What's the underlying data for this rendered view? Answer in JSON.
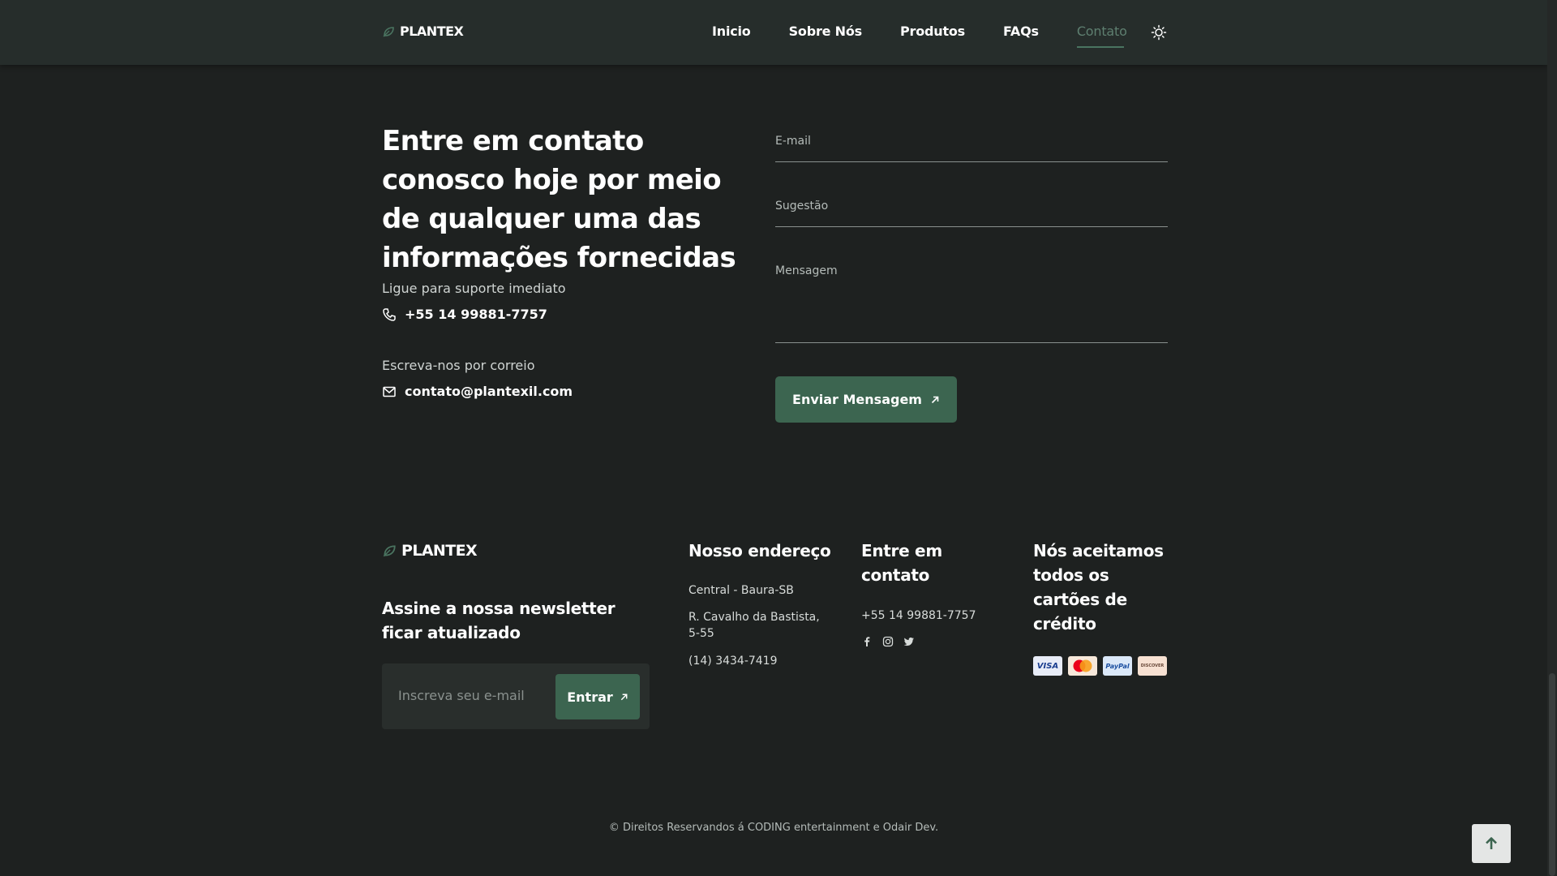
{
  "colors": {
    "background": "#1e2120",
    "header": "#262d2b",
    "accent": "#3c6550",
    "active_link": "#5e7f70"
  },
  "header": {
    "brand": "PLANTEX",
    "nav": [
      "Inicio",
      "Sobre Nós",
      "Produtos",
      "FAQs",
      "Contato"
    ],
    "active_nav": "Contato",
    "theme_icon": "sun-icon"
  },
  "contact": {
    "title": "Entre em contato conosco hoje por meio de qualquer uma das informações fornecidas",
    "phone_label": "Ligue para suporte imediato",
    "phone": "+55 14 99881-7757",
    "mail_label": "Escreva-nos por correio",
    "email": "contato@plantexil.com"
  },
  "form": {
    "email_placeholder": "E-mail",
    "suggestion_placeholder": "Sugestão",
    "message_placeholder": "Mensagem",
    "submit_label": "Enviar Mensagem"
  },
  "footer": {
    "brand": "PLANTEX",
    "newsletter_title": "Assine a nossa newsletter ficar atualizado",
    "newsletter_placeholder": "Inscreva seu e-mail",
    "newsletter_button": "Entrar",
    "address_title": "Nosso endereço",
    "address_lines": [
      "Central - Baura-SB",
      "R. Cavalho da Bastista, 5-55",
      "(14) 3434-7419"
    ],
    "contact_title": "Entre em contato",
    "contact_phone": "+55 14 99881-7757",
    "social_icons": [
      "facebook-icon",
      "instagram-icon",
      "twitter-icon"
    ],
    "cards_title": "Nós aceitamos todos os cartões de crédito",
    "cards": [
      "VISA",
      "mastercard",
      "PayPal",
      "DISCOVER"
    ],
    "copyright": "© Direitos Reservandos á CODING entertainment e Odair Dev."
  }
}
